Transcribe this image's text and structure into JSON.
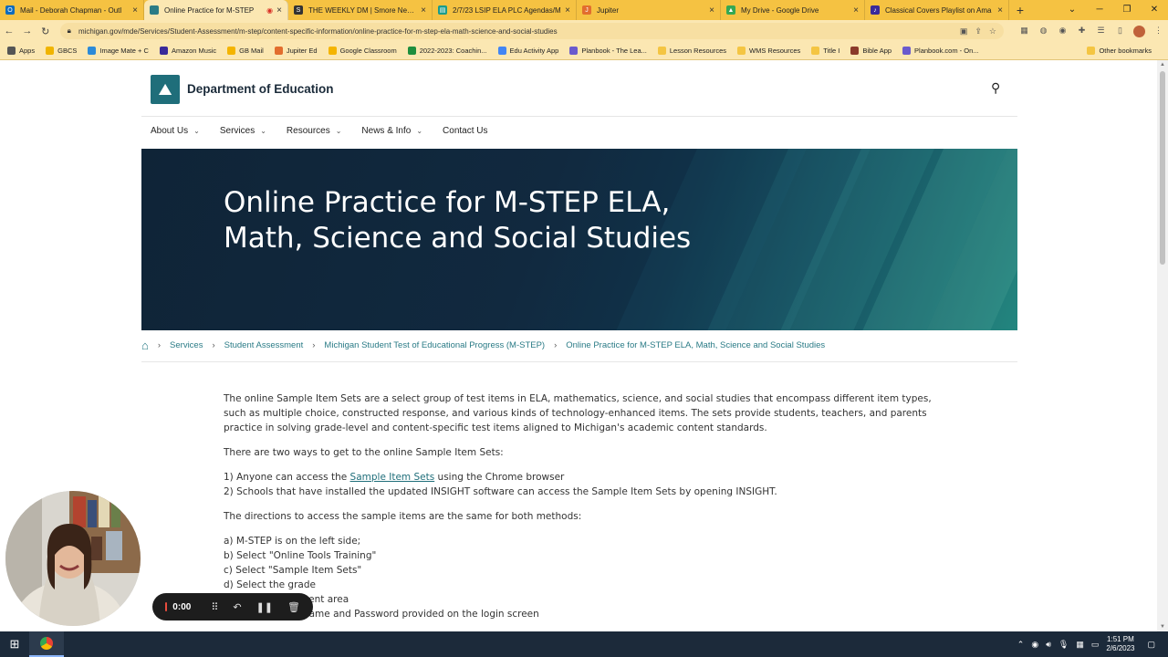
{
  "browser": {
    "tabs": [
      {
        "title": "Mail - Deborah Chapman - Outl",
        "fav_color": "#0f6cbd",
        "fav_glyph": "O"
      },
      {
        "title": "Online Practice for M-STEP",
        "fav_color": "#2a7b86",
        "fav_glyph": "",
        "recording": true
      },
      {
        "title": "THE WEEKLY DM | Smore Newsl",
        "fav_color": "#333333",
        "fav_glyph": "S"
      },
      {
        "title": "2/7/23 LSIP ELA PLC Agendas/M",
        "fav_color": "#1a9c8c",
        "fav_glyph": "▤"
      },
      {
        "title": "Jupiter",
        "fav_color": "#e26d2e",
        "fav_glyph": "J"
      },
      {
        "title": "My Drive - Google Drive",
        "fav_color": "#34a853",
        "fav_glyph": "▲"
      },
      {
        "title": "Classical Covers Playlist on Ama",
        "fav_color": "#3a2a9a",
        "fav_glyph": "♪"
      }
    ],
    "new_tab": "+",
    "url": "michigan.gov/mde/Services/Student-Assessment/m-step/content-specific-information/online-practice-for-m-step-ela-math-science-and-social-studies",
    "bookmarks": [
      {
        "label": "Apps",
        "color": "#555555"
      },
      {
        "label": "GBCS",
        "color": "#f0b400"
      },
      {
        "label": "Image Mate + C",
        "color": "#2c8ad8"
      },
      {
        "label": "Amazon Music",
        "color": "#3a2a9a"
      },
      {
        "label": "GB Mail",
        "color": "#f4b400"
      },
      {
        "label": "Jupiter Ed",
        "color": "#e26d2e"
      },
      {
        "label": "Google Classroom",
        "color": "#f4b400"
      },
      {
        "label": "2022-2023: Coachin...",
        "color": "#1e8e3e"
      },
      {
        "label": "Edu Activity App",
        "color": "#4285f4"
      },
      {
        "label": "Planbook - The Lea...",
        "color": "#6a5acd"
      },
      {
        "label": "Lesson Resources",
        "color": "#f4c542"
      },
      {
        "label": "WMS Resources",
        "color": "#f4c542"
      },
      {
        "label": "Title I",
        "color": "#f4c542"
      },
      {
        "label": "Bible App",
        "color": "#8b3a2a"
      },
      {
        "label": "Planbook.com - On...",
        "color": "#6a5acd"
      }
    ],
    "other_bookmarks": "Other bookmarks"
  },
  "site": {
    "name": "Department of Education",
    "nav": [
      "About Us",
      "Services",
      "Resources",
      "News & Info",
      "Contact Us"
    ],
    "nav_has_dropdown": [
      true,
      true,
      true,
      true,
      false
    ]
  },
  "hero": {
    "title": "Online Practice for M-STEP ELA, Math, Science and Social Studies"
  },
  "breadcrumb": [
    "Services",
    "Student Assessment",
    "Michigan Student Test of Educational Progress (M-STEP)",
    "Online Practice for M-STEP ELA, Math, Science and Social Studies"
  ],
  "content": {
    "intro": "The online Sample Item Sets are a select group of test items in ELA, mathematics, science, and social studies that encompass different item types, such as multiple choice, constructed response, and various kinds of technology-enhanced items. The sets provide students, teachers, and parents practice in solving grade-level and content-specific test items aligned to Michigan's academic content standards.",
    "ways_heading": "There are two ways to get to the online Sample Item Sets:",
    "way1_prefix": "1) Anyone can access the ",
    "way1_link": "Sample Item Sets",
    "way1_suffix": " using the Chrome browser",
    "way2": "2) Schools that have installed the updated INSIGHT software can access the Sample Item Sets by opening INSIGHT.",
    "directions_heading": "The directions to access the sample items are the same for both methods:",
    "steps": [
      "a) M-STEP is on the left side;",
      "b) Select \"Online Tools Training\"",
      "c) Select \"Sample Item Sets\"",
      "d) Select the grade",
      "e) Select the content area",
      "f) Enter the Username and Password provided on the login screen"
    ]
  },
  "recorder": {
    "time": "0:00"
  },
  "taskbar": {
    "time": "1:51 PM",
    "date": "2/6/2023"
  }
}
